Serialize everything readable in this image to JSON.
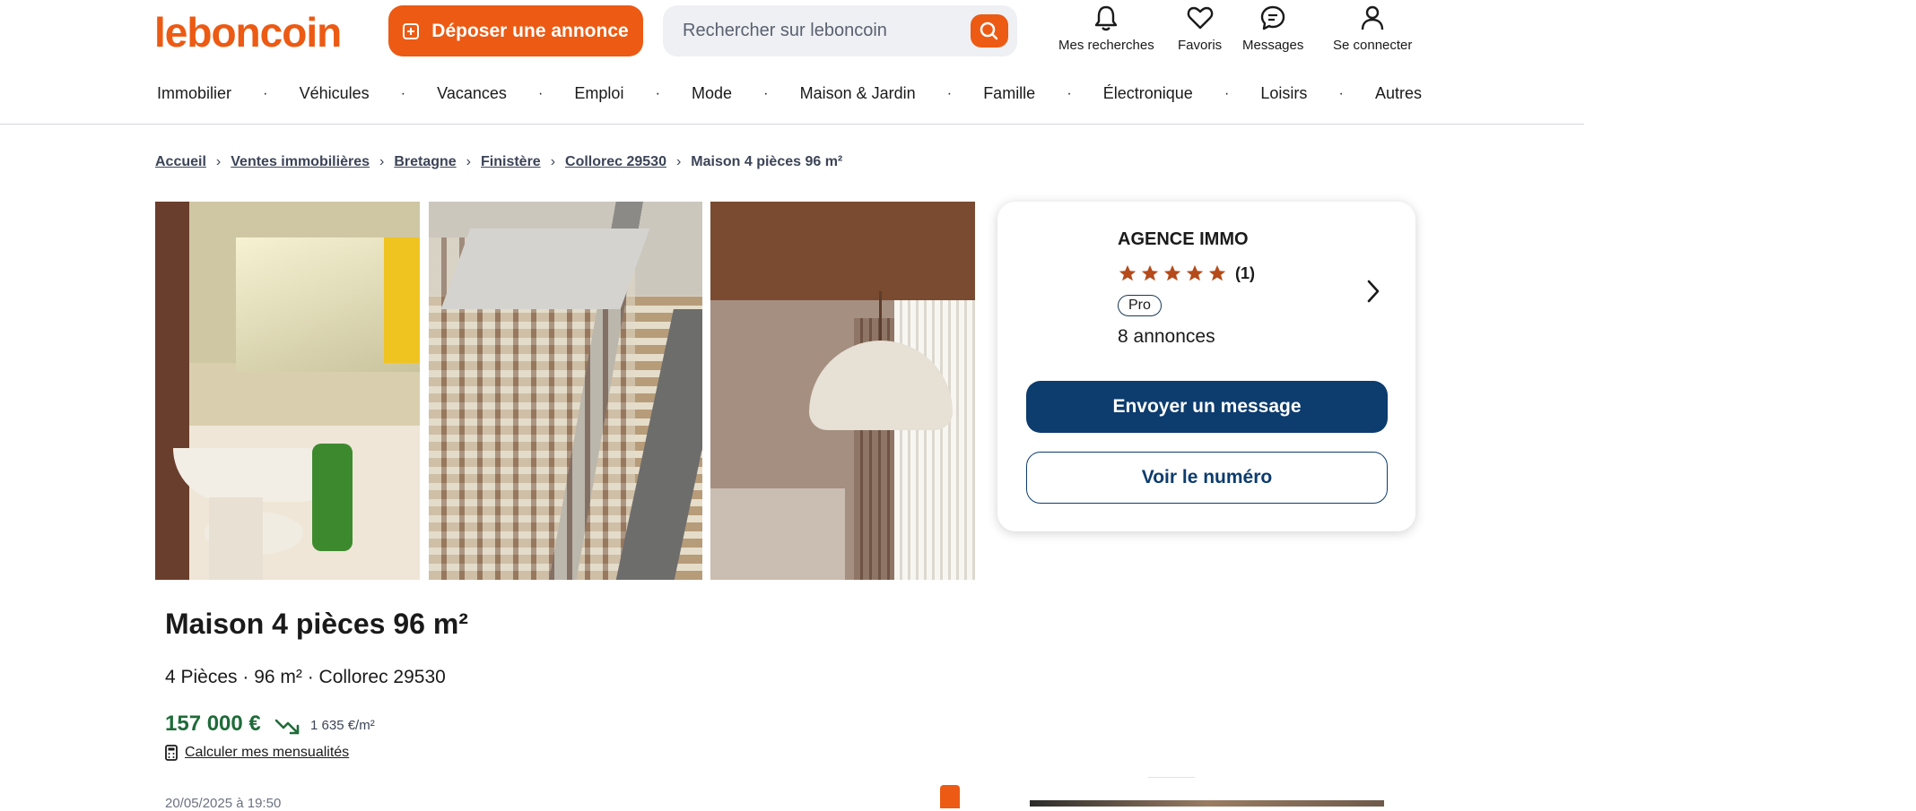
{
  "header": {
    "logo": "leboncoin",
    "post_ad_label": "Déposer une annonce",
    "search_placeholder": "Rechercher sur leboncoin",
    "nav": [
      {
        "label": "Mes recherches",
        "icon": "bell-icon"
      },
      {
        "label": "Favoris",
        "icon": "heart-icon"
      },
      {
        "label": "Messages",
        "icon": "chat-icon"
      },
      {
        "label": "Se connecter",
        "icon": "user-icon"
      }
    ]
  },
  "categories": [
    "Immobilier",
    "Véhicules",
    "Vacances",
    "Emploi",
    "Mode",
    "Maison & Jardin",
    "Famille",
    "Électronique",
    "Loisirs",
    "Autres"
  ],
  "category_separator": "·",
  "breadcrumb": {
    "items": [
      "Accueil",
      "Ventes immobilières",
      "Bretagne",
      "Finistère",
      "Collorec 29530"
    ],
    "current": "Maison 4 pièces 96 m²"
  },
  "seller": {
    "name": "AGENCE IMMO",
    "rating_count": "(1)",
    "stars": 5,
    "badge": "Pro",
    "listings": "8 annonces",
    "message_button": "Envoyer un message",
    "phone_button": "Voir le numéro",
    "star_color": "#b54a1a"
  },
  "listing": {
    "title": "Maison 4 pièces 96 m²",
    "subtitle": "4 Pièces · 96 m² · Collorec 29530",
    "price": "157 000 €",
    "price_per_m2": "1 635 €/m²",
    "calc_link": "Calculer mes mensualités",
    "date": "20/05/2025 à 19:50"
  },
  "colors": {
    "brand": "#ec5a13",
    "primary_button": "#0d3c6e",
    "price": "#1f6b3a"
  }
}
